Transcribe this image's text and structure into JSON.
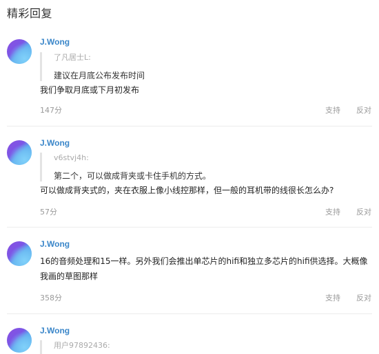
{
  "page_title": "精彩回复",
  "replies": [
    {
      "username": "J.Wong",
      "quote_user": "了凡居士L:",
      "quote_text": "建议在月底公布发布时间",
      "text": "我们争取月底或下月初发布",
      "score": "147分",
      "support": "支持",
      "oppose": "反对"
    },
    {
      "username": "J.Wong",
      "quote_user": "v6stvj4h:",
      "quote_text": "第二个，可以做成背夹或卡住手机的方式。",
      "text": "可以做成背夹式的，夹在衣服上像小线控那样，但一般的耳机带的线很长怎么办?",
      "score": "57分",
      "support": "支持",
      "oppose": "反对"
    },
    {
      "username": "J.Wong",
      "text": "16的音频处理和15一样。另外我们会推出单芯片的hifi和独立多芯片的hifi供选择。大概像我画的草图那样",
      "score": "358分",
      "support": "支持",
      "oppose": "反对"
    },
    {
      "username": "J.Wong",
      "quote_user": "用户97892436:"
    }
  ]
}
